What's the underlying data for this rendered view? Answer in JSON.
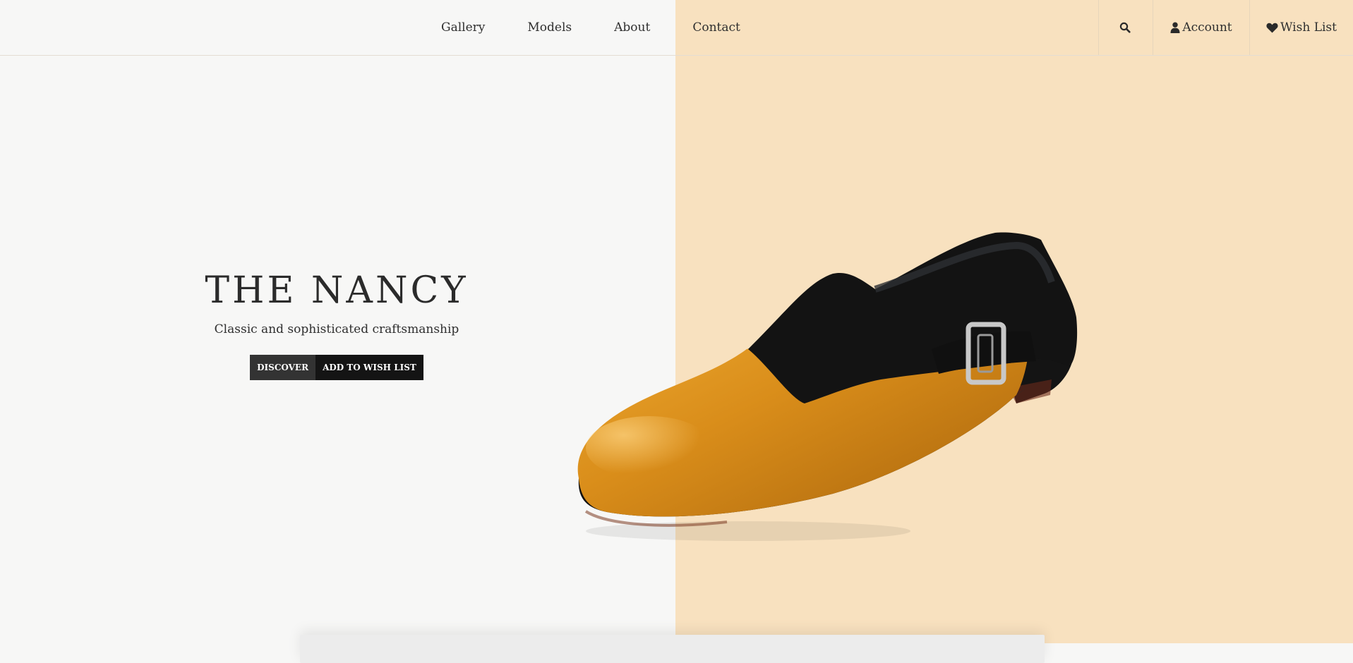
{
  "nav": {
    "links": [
      "Gallery",
      "Models",
      "About",
      "Contact"
    ],
    "account_label": "Account",
    "wishlist_label": "Wish List"
  },
  "hero": {
    "title": "THE NANCY",
    "subtitle": "Classic and sophisticated craftsmanship",
    "discover_label": "DISCOVER",
    "add_wishlist_label": "ADD TO WISH LIST"
  },
  "icons": {
    "search": "search-icon",
    "account": "user-icon",
    "wishlist": "heart-icon"
  },
  "colors": {
    "left_bg": "#f7f7f6",
    "right_bg": "#f8e1bf",
    "text": "#2b2b2b",
    "button_dark": "#333333",
    "button_black": "#141414",
    "leather": "#d9901f",
    "suede": "#151515"
  }
}
